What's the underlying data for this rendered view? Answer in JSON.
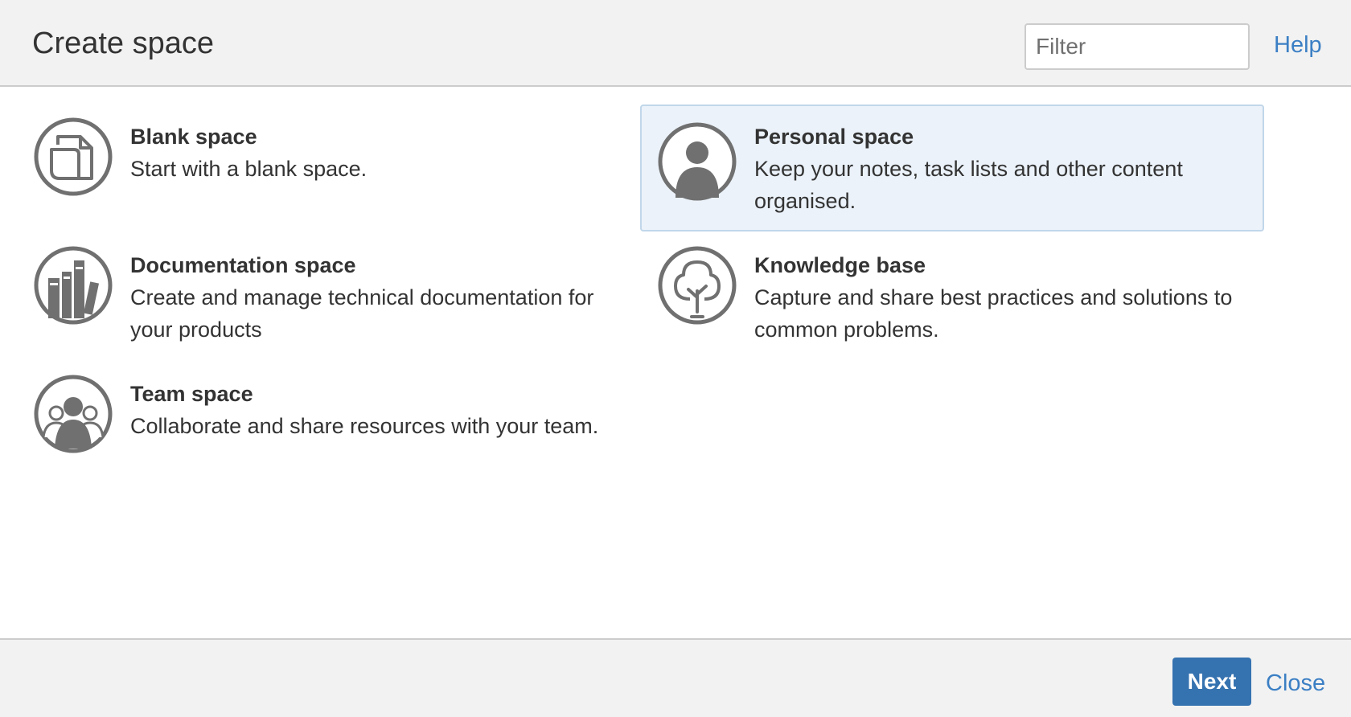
{
  "dialog": {
    "title": "Create space",
    "filter": {
      "placeholder": "Filter",
      "value": ""
    },
    "help_label": "Help"
  },
  "templates": [
    {
      "name": "Blank space",
      "description": "Start with a blank space.",
      "icon": "blank-page-icon",
      "selected": false
    },
    {
      "name": "Personal space",
      "description": "Keep your notes, task lists and other content organised.",
      "icon": "person-icon",
      "selected": true
    },
    {
      "name": "Documentation space",
      "description": "Create and manage technical documentation for your products",
      "icon": "books-icon",
      "selected": false
    },
    {
      "name": "Knowledge base",
      "description": "Capture and share best practices and solutions to common problems.",
      "icon": "tree-icon",
      "selected": false
    },
    {
      "name": "Team space",
      "description": "Collaborate and share resources with your team.",
      "icon": "team-icon",
      "selected": false
    }
  ],
  "footer": {
    "next_label": "Next",
    "close_label": "Close"
  },
  "colors": {
    "primary_button": "#3572b0",
    "link": "#3b7fc4",
    "selected_bg": "#ebf2f9",
    "icon_gray": "#707070"
  }
}
